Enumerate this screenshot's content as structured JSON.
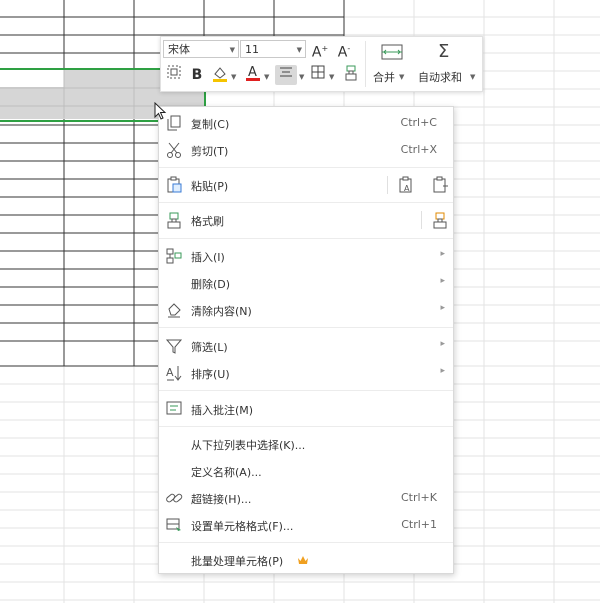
{
  "toolbar": {
    "font_name": "宋体",
    "font_size": "11",
    "merge_label": "合并",
    "autosum_label": "自动求和"
  },
  "menu": {
    "copy": {
      "label": "复制(C)",
      "shortcut": "Ctrl+C"
    },
    "cut": {
      "label": "剪切(T)",
      "shortcut": "Ctrl+X"
    },
    "paste": {
      "label": "粘贴(P)"
    },
    "format_painter": {
      "label": "格式刷"
    },
    "insert": {
      "label": "插入(I)"
    },
    "delete": {
      "label": "删除(D)"
    },
    "clear": {
      "label": "清除内容(N)"
    },
    "filter": {
      "label": "筛选(L)"
    },
    "sort": {
      "label": "排序(U)"
    },
    "insert_comment": {
      "label": "插入批注(M)"
    },
    "pick_from_list": {
      "label": "从下拉列表中选择(K)..."
    },
    "define_name": {
      "label": "定义名称(A)..."
    },
    "hyperlink": {
      "label": "超链接(H)...",
      "shortcut": "Ctrl+K"
    },
    "format_cells": {
      "label": "设置单元格格式(F)...",
      "shortcut": "Ctrl+1"
    },
    "batch_cells": {
      "label": "批量处理单元格(P)"
    }
  },
  "colors": {
    "selection_border": "#2ea043",
    "selection_fill": "#d6d6d6",
    "grid_dark": "#333333",
    "grid_light": "#e3e3e3",
    "highlight_yellow": "#f5c400",
    "font_red": "#e02020",
    "crown": "#f0a020"
  },
  "icons": [
    "copy-icon",
    "cut-icon",
    "paste-icon",
    "format-painter-icon",
    "insert-icon",
    "clear-icon",
    "filter-icon",
    "sort-icon",
    "comment-icon",
    "link-icon",
    "format-cells-icon",
    "crown-icon"
  ]
}
